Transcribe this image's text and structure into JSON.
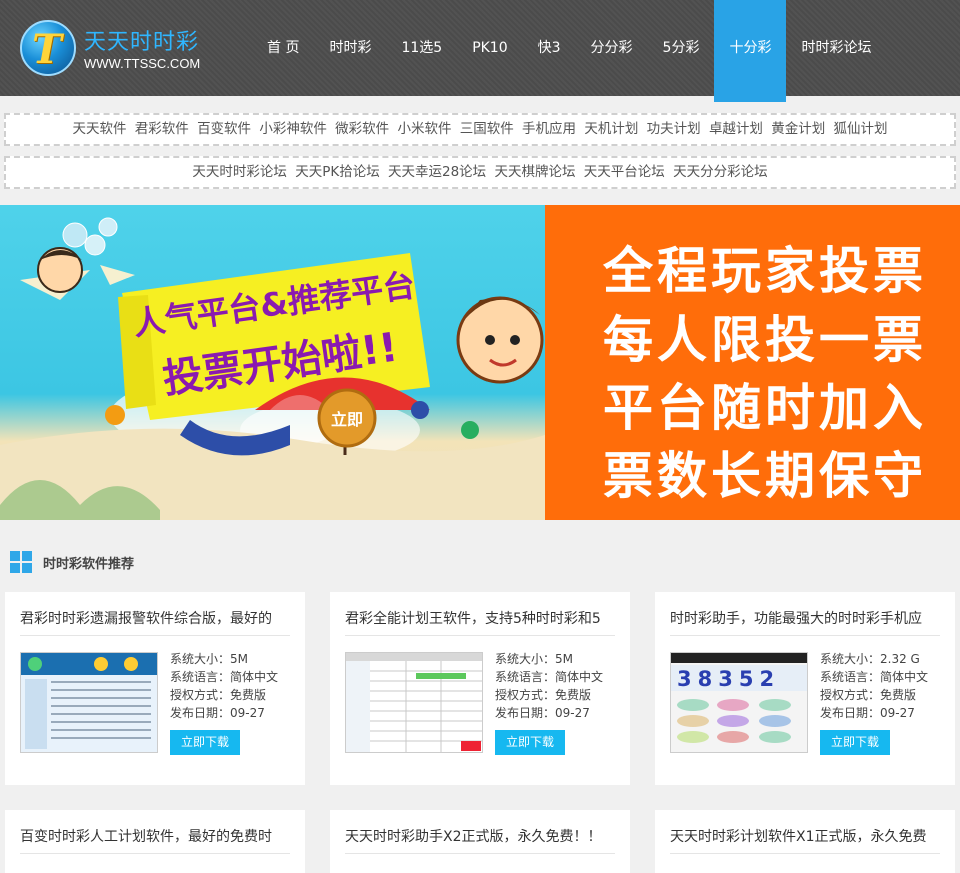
{
  "brand": {
    "name_cn": "天天时时彩",
    "name_en": "WWW.TTSSC.COM"
  },
  "nav": [
    {
      "label": "首 页"
    },
    {
      "label": "时时彩"
    },
    {
      "label": "11选5"
    },
    {
      "label": "PK10"
    },
    {
      "label": "快3"
    },
    {
      "label": "分分彩"
    },
    {
      "label": "5分彩"
    },
    {
      "label": "十分彩",
      "active": true
    },
    {
      "label": "时时彩论坛"
    }
  ],
  "software_links": [
    "天天软件",
    "君彩软件",
    "百变软件",
    "小彩神软件",
    "微彩软件",
    "小米软件",
    "三国软件",
    "手机应用",
    "天机计划",
    "功夫计划",
    "卓越计划",
    "黄金计划",
    "狐仙计划"
  ],
  "forum_links": [
    "天天时时彩论坛",
    "天天PK拾论坛",
    "天天幸运28论坛",
    "天天棋牌论坛",
    "天天平台论坛",
    "天天分分彩论坛"
  ],
  "banner": {
    "left_headline": "人气平台&推荐平台",
    "left_sub": "投票开始啦!!",
    "left_button": "立即",
    "slogan": [
      "全程玩家投票",
      "每人限投一票",
      "平台随时加入",
      "票数长期保守"
    ]
  },
  "section": {
    "title": "时时彩软件推荐"
  },
  "cards": [
    {
      "title": "君彩时时彩遗漏报警软件综合版，最好的",
      "size": "系统大小：5M",
      "lang": "系统语言：简体中文",
      "license": "授权方式：免费版",
      "date": "发布日期：09-27",
      "button": "立即下载",
      "thumb": "grid"
    },
    {
      "title": "君彩全能计划王软件，支持5种时时彩和5",
      "size": "系统大小：5M",
      "lang": "系统语言：简体中文",
      "license": "授权方式：免费版",
      "date": "发布日期：09-27",
      "button": "立即下载",
      "thumb": "table"
    },
    {
      "title": "时时彩助手，功能最强大的时时彩手机应",
      "size": "系统大小：2.32 G",
      "lang": "系统语言：简体中文",
      "license": "授权方式：免费版",
      "date": "发布日期：09-27",
      "button": "立即下载",
      "thumb": "phone",
      "thumb_number": "38352"
    },
    {
      "title": "百变时时彩人工计划软件，最好的免费时"
    },
    {
      "title": "天天时时彩助手X2正式版，永久免费！！"
    },
    {
      "title": "天天时时彩计划软件X1正式版，永久免费"
    }
  ],
  "colors": {
    "header_bg": "#4d4d4d",
    "accent": "#29a3e6",
    "banner_orange": "#ff6d0a",
    "button": "#16b8f0"
  }
}
